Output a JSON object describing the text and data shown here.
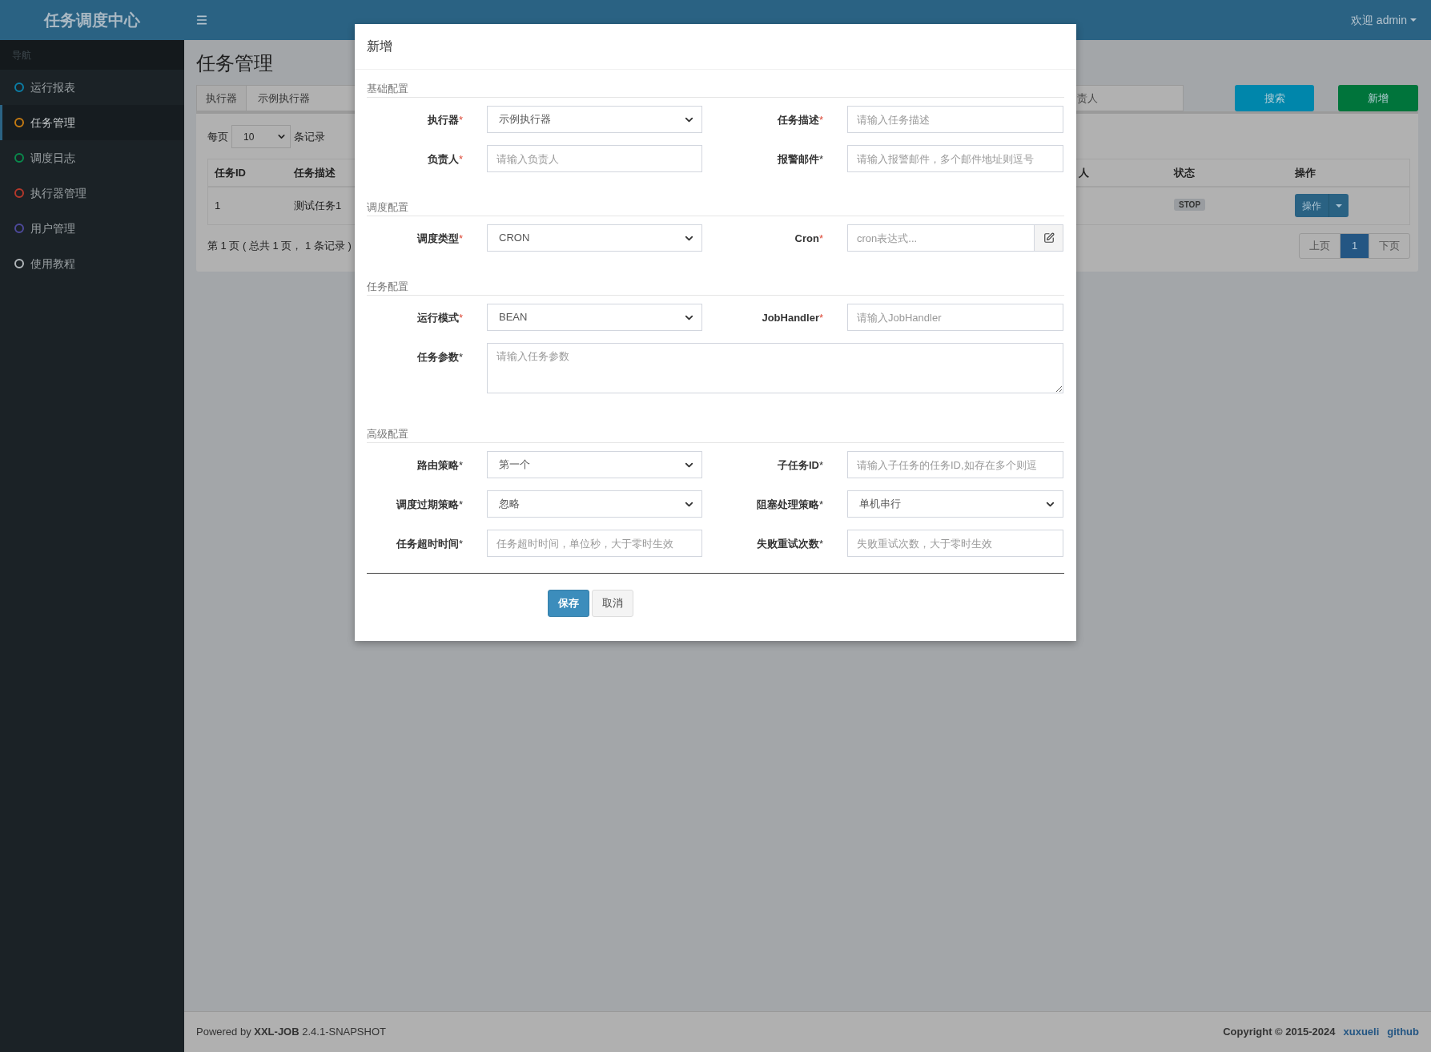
{
  "header": {
    "logo": "任务调度中心",
    "user": "欢迎 admin"
  },
  "sidebar": {
    "heading": "导航",
    "items": [
      {
        "label": "运行报表",
        "color": "#0b7ea6",
        "selected": false
      },
      {
        "label": "任务管理",
        "color": "#c47a12",
        "selected": true
      },
      {
        "label": "调度日志",
        "color": "#0a8a4c",
        "selected": false
      },
      {
        "label": "执行器管理",
        "color": "#b5382b",
        "selected": false
      },
      {
        "label": "用户管理",
        "color": "#4e4a9c",
        "selected": false
      },
      {
        "label": "使用教程",
        "color": "#b3b8bb",
        "selected": false
      }
    ]
  },
  "page": {
    "title": "任务管理",
    "executor_label": "执行器",
    "executor_value": "示例执行器",
    "search_field": {
      "placeholder": "责人"
    },
    "buttons": [
      {
        "label": "搜索",
        "kind": "search"
      },
      {
        "label": "新增",
        "kind": "add"
      }
    ],
    "page_size": {
      "prefix": "每页",
      "value": "10",
      "suffix": "条记录"
    },
    "table": {
      "columns": [
        "任务ID",
        "任务描述",
        "人",
        "状态",
        "操作"
      ],
      "rows": [
        {
          "id": "1",
          "description": "测试任务1",
          "status": "STOP",
          "action": "操作"
        }
      ]
    },
    "summary": "第 1 页 ( 总共 1 页， 1 条记录 )",
    "pagination": [
      {
        "label": "上页",
        "selected": false
      },
      {
        "label": "1",
        "selected": true
      },
      {
        "label": "下页",
        "selected": false
      }
    ]
  },
  "modal": {
    "title": "新增",
    "sections": [
      {
        "title": "基础配置",
        "fields": [
          {
            "label": "执行器",
            "mark": "*",
            "mark_red": true,
            "kind": "select",
            "value": "示例执行器"
          },
          {
            "label": "任务描述",
            "mark": "*",
            "mark_red": true,
            "kind": "input",
            "placeholder": "请输入任务描述"
          },
          {
            "label": "负责人",
            "mark": "*",
            "mark_red": true,
            "kind": "input",
            "placeholder": "请输入负责人"
          },
          {
            "label": "报警邮件",
            "mark": "*",
            "mark_red": false,
            "kind": "input",
            "placeholder": "请输入报警邮件，多个邮件地址则逗号"
          }
        ]
      },
      {
        "title": "调度配置",
        "fields": [
          {
            "label": "调度类型",
            "mark": "*",
            "mark_red": true,
            "kind": "select",
            "value": "CRON"
          },
          {
            "label": "Cron",
            "mark": "*",
            "mark_red": true,
            "kind": "input_button",
            "placeholder": "cron表达式..."
          }
        ]
      },
      {
        "title": "任务配置",
        "fields": [
          {
            "label": "运行模式",
            "mark": "*",
            "mark_red": true,
            "kind": "select",
            "value": "BEAN"
          },
          {
            "label": "JobHandler",
            "mark": "*",
            "mark_red": true,
            "kind": "input",
            "placeholder": "请输入JobHandler"
          },
          {
            "label": "任务参数",
            "mark": "*",
            "mark_red": false,
            "kind": "textarea",
            "placeholder": "请输入任务参数"
          }
        ]
      },
      {
        "title": "高级配置",
        "fields": [
          {
            "label": "路由策略",
            "mark": "*",
            "mark_red": false,
            "kind": "select",
            "value": "第一个"
          },
          {
            "label": "子任务ID",
            "mark": "*",
            "mark_red": false,
            "kind": "input",
            "placeholder": "请输入子任务的任务ID,如存在多个则逗"
          },
          {
            "label": "调度过期策略",
            "mark": "*",
            "mark_red": false,
            "kind": "select",
            "value": "忽略"
          },
          {
            "label": "阻塞处理策略",
            "mark": "*",
            "mark_red": false,
            "kind": "select",
            "value": "单机串行"
          },
          {
            "label": "任务超时时间",
            "mark": "*",
            "mark_red": false,
            "kind": "input",
            "placeholder": "任务超时时间，单位秒，大于零时生效"
          },
          {
            "label": "失败重试次数",
            "mark": "*",
            "mark_red": false,
            "kind": "input",
            "placeholder": "失败重试次数，大于零时生效"
          }
        ]
      }
    ],
    "buttons": [
      {
        "label": "保存",
        "kind": "primary"
      },
      {
        "label": "取消",
        "kind": "default"
      }
    ]
  },
  "footer": {
    "powered": "Powered by **XXL-JOB** 2.4.1-SNAPSHOT",
    "copyright": "Copyright © 2015-2024",
    "links": [
      "xuxueli",
      "github"
    ]
  }
}
